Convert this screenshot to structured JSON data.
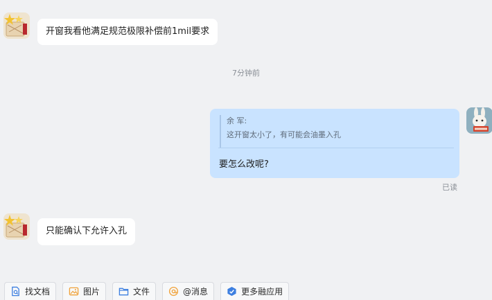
{
  "messages": {
    "msg1": {
      "text": "开窗我看他满足规范极限补偿前1mil要求"
    },
    "timestamp": "7分钟前",
    "own": {
      "quote_author": "余 军:",
      "quote_text": "这开窗太小了，有可能会油墨入孔",
      "text": "要怎么改呢?",
      "status": "已读"
    },
    "msg2": {
      "text": "只能确认下允许入孔"
    }
  },
  "toolbar": {
    "items": [
      {
        "label": "找文档",
        "icon": "find-doc-icon"
      },
      {
        "label": "图片",
        "icon": "image-icon"
      },
      {
        "label": "文件",
        "icon": "folder-icon"
      },
      {
        "label": "@消息",
        "icon": "at-icon"
      },
      {
        "label": "更多融应用",
        "icon": "apps-icon"
      }
    ]
  },
  "colors": {
    "background": "#f0f1f3",
    "own_bubble": "#c9e3ff",
    "other_bubble": "#ffffff",
    "accent_blue": "#3d7fe0",
    "accent_orange": "#f0a23a"
  }
}
